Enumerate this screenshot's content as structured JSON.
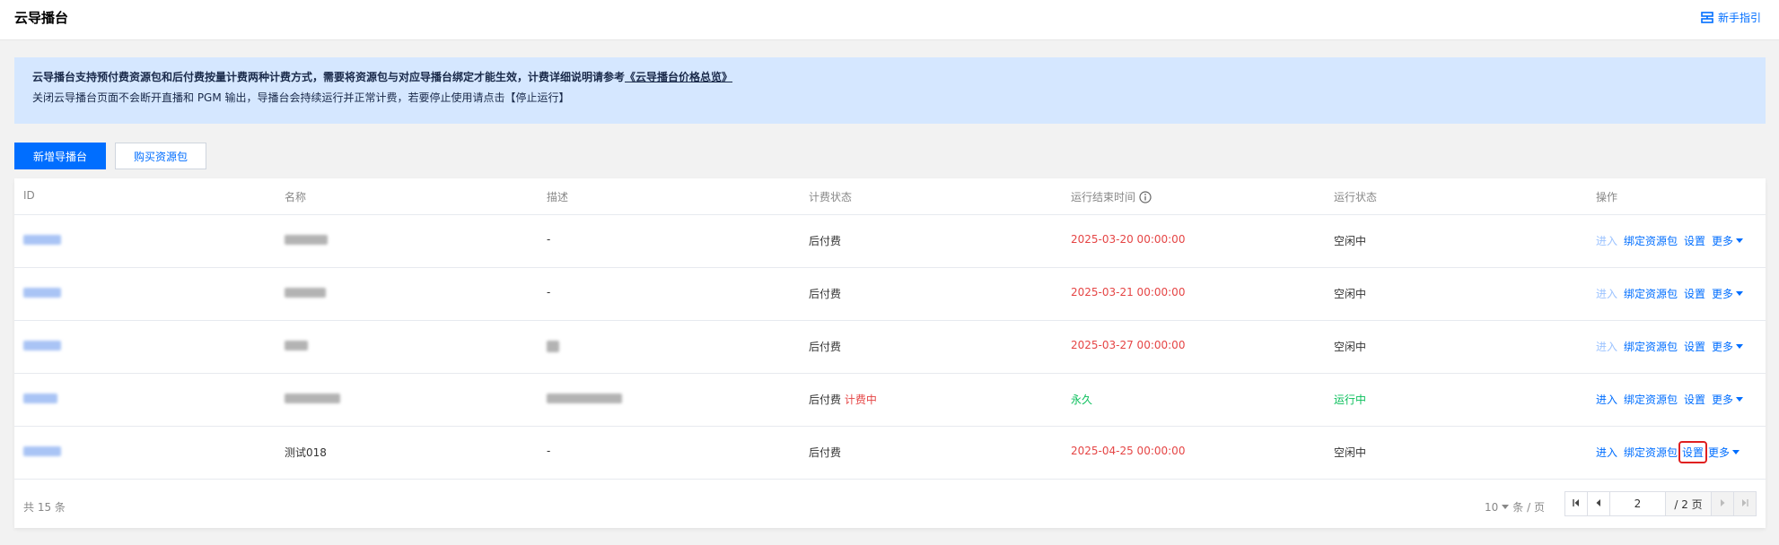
{
  "header": {
    "title": "云导播台",
    "guide_label": "新手指引",
    "guide_icon": "guide-icon"
  },
  "notice": {
    "line1_text": "云导播台支持预付费资源包和后付费按量计费两种计费方式，需要将资源包与对应导播台绑定才能生效，计费详细说明请参考",
    "line1_link": "《云导播台价格总览》",
    "line2_text": "关闭云导播台页面不会断开直播和 PGM 输出，导播台会持续运行并正常计费，若要停止使用请点击【停止运行】"
  },
  "toolbar": {
    "create_label": "新增导播台",
    "buy_label": "购买资源包"
  },
  "table": {
    "headers": {
      "id": "ID",
      "name": "名称",
      "desc": "描述",
      "billing": "计费状态",
      "end_time": "运行结束时间",
      "run_status": "运行状态",
      "actions": "操作"
    },
    "rows": [
      {
        "name": "",
        "desc": "-",
        "billing": "后付费",
        "billing_tag": "",
        "end_time": "2025-03-20 00:00:00",
        "run_status": "空闲中",
        "enter": "进入",
        "bind": "绑定资源包",
        "settings": "设置",
        "more": "更多"
      },
      {
        "name": "",
        "desc": "-",
        "billing": "后付费",
        "billing_tag": "",
        "end_time": "2025-03-21 00:00:00",
        "run_status": "空闲中",
        "enter": "进入",
        "bind": "绑定资源包",
        "settings": "设置",
        "more": "更多"
      },
      {
        "name": "",
        "desc": "",
        "billing": "后付费",
        "billing_tag": "",
        "end_time": "2025-03-27 00:00:00",
        "run_status": "空闲中",
        "enter": "进入",
        "bind": "绑定资源包",
        "settings": "设置",
        "more": "更多"
      },
      {
        "name": "",
        "desc": "",
        "billing": "后付费",
        "billing_tag": "计费中",
        "end_time": "永久",
        "run_status": "运行中",
        "enter": "进入",
        "bind": "绑定资源包",
        "settings": "设置",
        "more": "更多"
      },
      {
        "name": "测试018",
        "desc": "-",
        "billing": "后付费",
        "billing_tag": "",
        "end_time": "2025-04-25 00:00:00",
        "run_status": "空闲中",
        "enter": "进入",
        "bind": "绑定资源包",
        "settings": "设置",
        "more": "更多"
      }
    ]
  },
  "pagination": {
    "total_label": "共 15 条",
    "page_size": "10",
    "page_size_unit": "条 / 页",
    "current_page": "2",
    "total_pages": "/ 2 页"
  },
  "colors": {
    "accent": "#006eff",
    "notice_bg": "#d5e7ff",
    "danger": "#e54545",
    "success": "#0abf5b",
    "highlight_border": "#e02020"
  }
}
